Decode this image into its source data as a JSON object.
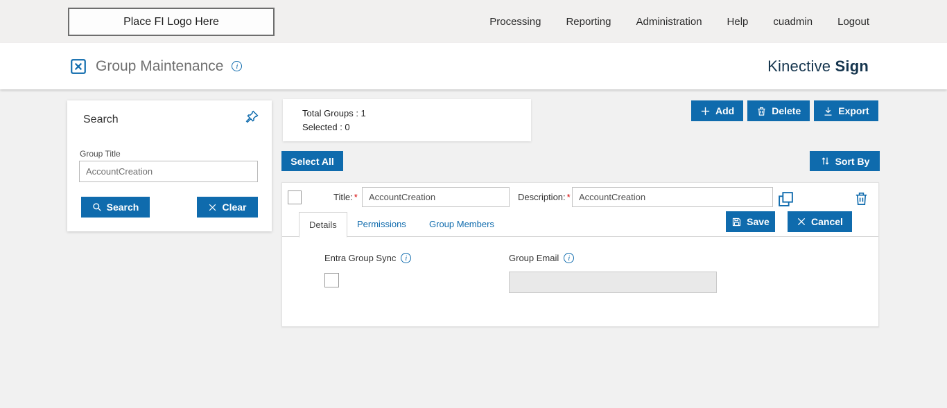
{
  "topbar": {
    "logo": "Place FI Logo Here",
    "nav": [
      "Processing",
      "Reporting",
      "Administration",
      "Help",
      "cuadmin",
      "Logout"
    ]
  },
  "header": {
    "title": "Group Maintenance",
    "brand_regular": "Kinective",
    "brand_bold": "Sign"
  },
  "search": {
    "title": "Search",
    "group_title_label": "Group Title",
    "group_title_value": "AccountCreation",
    "search_label": "Search",
    "clear_label": "Clear"
  },
  "summary": {
    "total": "Total Groups : 1",
    "selected": "Selected : 0"
  },
  "actions": {
    "add": "Add",
    "delete": "Delete",
    "export": "Export",
    "select_all": "Select All",
    "sort_by": "Sort By"
  },
  "group": {
    "title_label": "Title:",
    "description_label": "Description:",
    "required": "*",
    "title_value": "AccountCreation",
    "description_value": "AccountCreation",
    "tabs": [
      "Details",
      "Permissions",
      "Group Members"
    ],
    "save": "Save",
    "cancel": "Cancel",
    "entra_label": "Entra Group Sync",
    "email_label": "Group Email",
    "email_value": ""
  },
  "colors": {
    "accent": "#0f6bad",
    "brand_text": "#14344d"
  }
}
